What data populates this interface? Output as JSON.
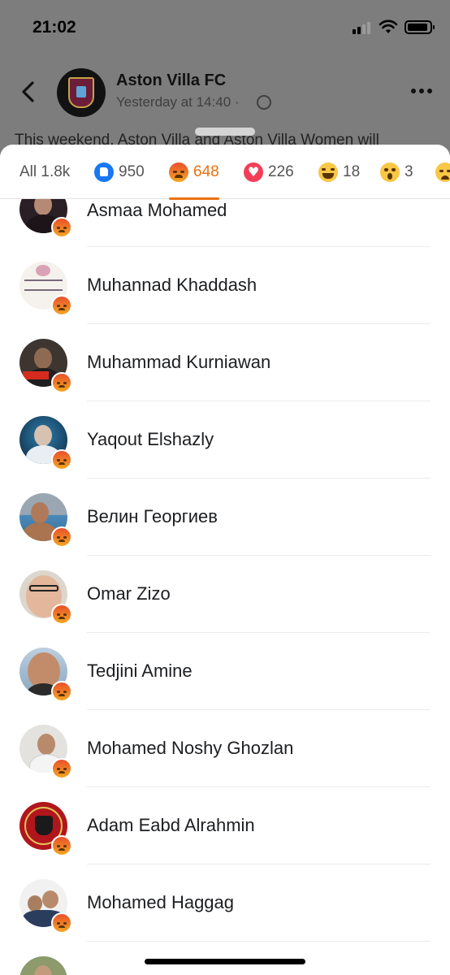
{
  "status_bar": {
    "time": "21:02"
  },
  "post": {
    "page_name": "Aston Villa FC",
    "time": "Yesterday at 14:40 ·",
    "text_preview": "This weekend, Aston Villa and Aston Villa Women will"
  },
  "tabs": [
    {
      "label": "All 1.8k",
      "icon": ""
    },
    {
      "label": "950",
      "icon": "like-icon"
    },
    {
      "label": "648",
      "icon": "angry-icon",
      "active": true
    },
    {
      "label": "226",
      "icon": "love-icon"
    },
    {
      "label": "18",
      "icon": "haha-icon"
    },
    {
      "label": "3",
      "icon": "wow-icon"
    },
    {
      "label": "",
      "icon": "sad-icon"
    }
  ],
  "reactors": [
    {
      "name": "Asmaa Mohamed",
      "reaction": "angry-icon"
    },
    {
      "name": "Muhannad Khaddash",
      "reaction": "angry-icon"
    },
    {
      "name": "Muhammad Kurniawan",
      "reaction": "angry-icon"
    },
    {
      "name": "Yaqout Elshazly",
      "reaction": "angry-icon"
    },
    {
      "name": "Велин Георгиев",
      "reaction": "angry-icon"
    },
    {
      "name": "Omar Zizo",
      "reaction": "angry-icon"
    },
    {
      "name": "Tedjini Amine",
      "reaction": "angry-icon"
    },
    {
      "name": "Mohamed Noshy Ghozlan",
      "reaction": "angry-icon"
    },
    {
      "name": "Adam Eabd Alrahmin",
      "reaction": "angry-icon"
    },
    {
      "name": "Mohamed Haggag",
      "reaction": "angry-icon"
    }
  ],
  "colors": {
    "accent": "#e9710f",
    "like": "#1877f2",
    "love": "#f33e58"
  }
}
